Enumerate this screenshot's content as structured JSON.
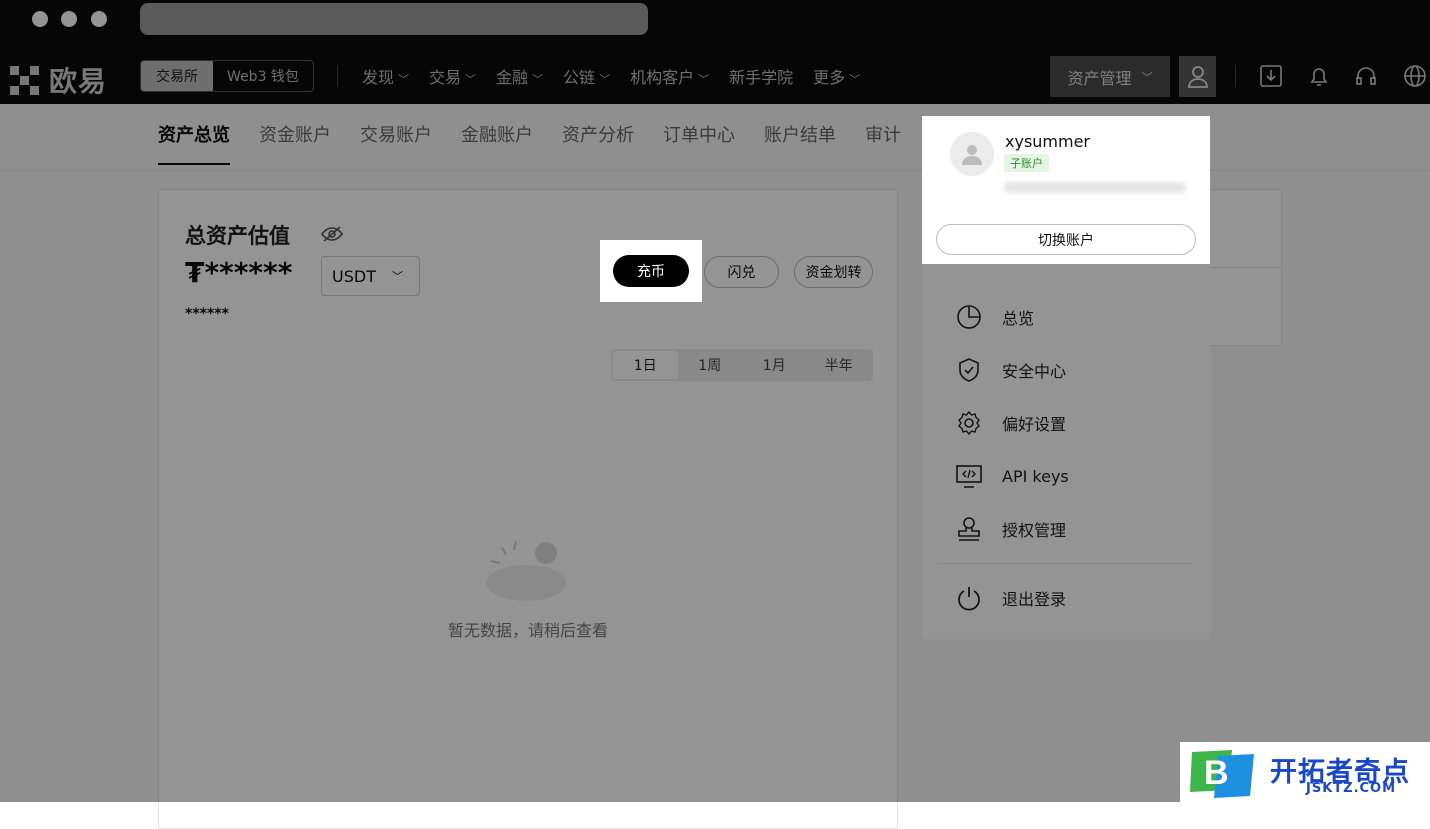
{
  "brand": {
    "name": "欧易"
  },
  "mode_switch": {
    "exchange": "交易所",
    "web3": "Web3 钱包"
  },
  "nav": {
    "items": [
      "发现",
      "交易",
      "金融",
      "公链",
      "机构客户",
      "新手学院",
      "更多"
    ],
    "chevron": "⌄"
  },
  "header": {
    "asset_mgmt": "资产管理"
  },
  "top_icons": [
    "download-icon",
    "bell-icon",
    "headset-icon",
    "globe-icon"
  ],
  "subnav": {
    "tabs": [
      "资产总览",
      "资金账户",
      "交易账户",
      "金融账户",
      "资产分析",
      "订单中心",
      "账户结单",
      "审计"
    ]
  },
  "overview": {
    "title": "总资产估值",
    "value": "₮******",
    "sub_value": "******",
    "currency": "USDT",
    "deposit": "充币",
    "convert": "闪兑",
    "transfer": "资金划转",
    "periods": [
      "1日",
      "1周",
      "1月",
      "半年"
    ],
    "selected_period": "1日",
    "empty_text": "暂无数据，请稍后查看"
  },
  "account_menu": {
    "username": "xysummer",
    "badge": "子账户",
    "switch_label": "切换账户",
    "items": [
      {
        "label": "总览",
        "icon": "pie-chart-icon"
      },
      {
        "label": "安全中心",
        "icon": "shield-check-icon"
      },
      {
        "label": "偏好设置",
        "icon": "gear-icon"
      },
      {
        "label": "API keys",
        "icon": "code-monitor-icon"
      },
      {
        "label": "授权管理",
        "icon": "stamp-icon"
      }
    ],
    "logout": "退出登录"
  },
  "watermark": {
    "title": "开拓者奇点",
    "subtitle": "JSKTZ.COM",
    "letter": "B"
  },
  "colors": {
    "overlay": "rgba(0,0,0,0.42)",
    "badge_green": "#2a8a2a",
    "watermark_blue": "#1a46c8"
  }
}
